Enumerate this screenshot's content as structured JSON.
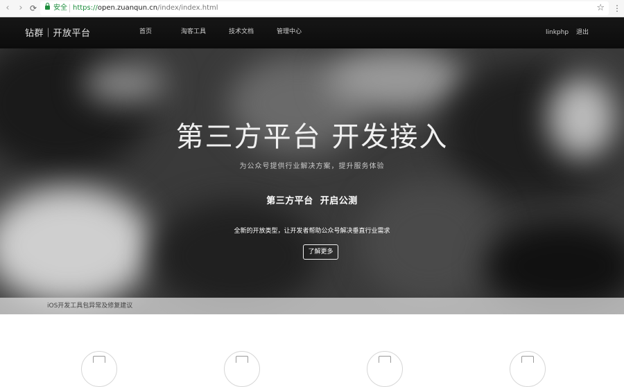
{
  "browser": {
    "back_icon": "‹",
    "forward_icon": "›",
    "reload_icon": "⟳",
    "secure_label": "安全",
    "url_scheme": "https://",
    "url_host": "open.zuanqun.cn",
    "url_path": "/index/index.html",
    "bookmark_icon": "☆",
    "menu_icon": "⋮"
  },
  "header": {
    "brand": "钻群｜开放平台",
    "nav": [
      "首页",
      "淘客工具",
      "技术文档",
      "管理中心"
    ],
    "user": "linkphp",
    "logout": "退出"
  },
  "hero": {
    "title": "第三方平台 开发接入",
    "subtitle": "为公众号提供行业解决方案，提升服务体验",
    "headline": "第三方平台  开启公测",
    "description": "全新的开放类型，让开发者帮助公众号解决垂直行业需求",
    "button_label": "了解更多",
    "notice": "iOS开发工具包异常及修复建议"
  },
  "colors": {
    "header_bg": "#111111",
    "secure_green": "#1e8e3e"
  }
}
